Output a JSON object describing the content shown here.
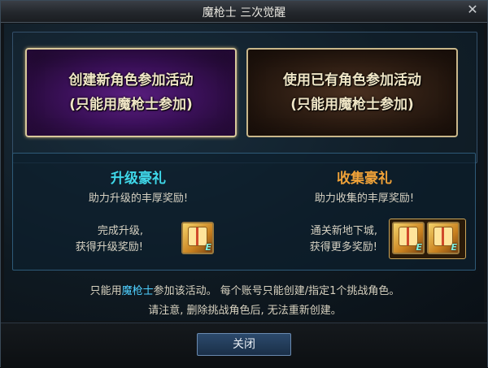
{
  "window": {
    "title": "魔枪士 三次觉醒",
    "close_icon": "close-icon"
  },
  "buttons": {
    "new_char_line1": "创建新角色参加活动",
    "new_char_line2": "(只能用魔枪士参加)",
    "existing_char_line1": "使用已有角色参加活动",
    "existing_char_line2": "(只能用魔枪士参加)",
    "close_label": "关闭"
  },
  "rewards": {
    "upgrade": {
      "title": "升级豪礼",
      "subtitle": "助力升级的丰厚奖励!",
      "desc_line1": "完成升级,",
      "desc_line2": "获得升级奖励!"
    },
    "collect": {
      "title": "收集豪礼",
      "subtitle": "助力收集的丰厚奖励!",
      "desc_line1": "通关新地下城,",
      "desc_line2": "获得更多奖励!"
    },
    "item_mark": "E"
  },
  "notice": {
    "line1_prefix": "只能用",
    "line1_highlight": "魔枪士",
    "line1_suffix": "参加该活动。 每个账号只能创建/指定1个挑战角色。",
    "line2": "请注意, 删除挑战角色后, 无法重新创建。"
  },
  "colors": {
    "upgrade_title": "#3fd7e8",
    "collect_title": "#f0a238",
    "highlight": "#4fd0ff"
  }
}
